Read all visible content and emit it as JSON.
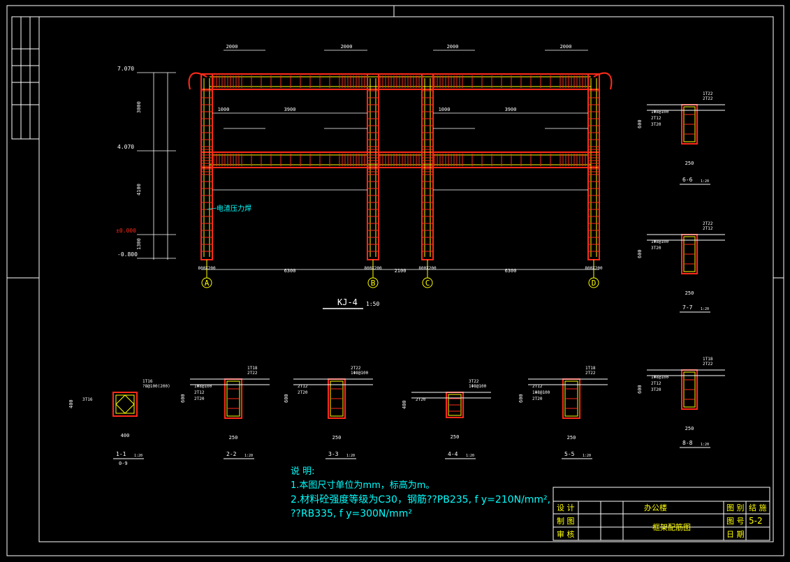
{
  "frame_title": {
    "text": "KJ-4",
    "scale": "1:50"
  },
  "axis_labels": [
    "A",
    "B",
    "C",
    "D"
  ],
  "span_labels": [
    "6300",
    "2100",
    "6300"
  ],
  "elevations": [
    "7.070",
    "4.070",
    "±0.000",
    "-0.800"
  ],
  "vertical_dims": [
    "3000",
    "4100",
    "1300"
  ],
  "top_dims": [
    "2000",
    "2000",
    "2000",
    "2000"
  ],
  "mid_dims": [
    "3900",
    "1000",
    "1000",
    "3900"
  ],
  "annotation": "电渣压力焊",
  "column_base": [
    "800X200",
    "800X200",
    "800X200",
    "800X200"
  ],
  "sections": [
    {
      "label": "1-1",
      "sub": "0-9",
      "dims": [
        "400",
        "400"
      ],
      "rebar": [
        "1T16",
        "?8@100(200)",
        "3T16"
      ]
    },
    {
      "label": "2-2",
      "dims": [
        "600",
        "250"
      ],
      "rebar": [
        "1T18",
        "2T22",
        "1Φ8@100",
        "2T12",
        "2T20"
      ]
    },
    {
      "label": "3-3",
      "dims": [
        "600",
        "250"
      ],
      "rebar": [
        "2T22",
        "1Φ8@100",
        "2T12",
        "2T20"
      ]
    },
    {
      "label": "4-4",
      "dims": [
        "400",
        "250"
      ],
      "rebar": [
        "3T22",
        "1Φ8@100",
        "2T20"
      ]
    },
    {
      "label": "5-5",
      "dims": [
        "600",
        "250"
      ],
      "rebar": [
        "1T18",
        "2T22",
        "2T12",
        "1Φ8@100",
        "2T20"
      ]
    },
    {
      "label": "6-6",
      "dims": [
        "600",
        "250"
      ],
      "rebar": [
        "1T22",
        "2T22",
        "1Φ8@100",
        "2T12",
        "3T20"
      ]
    },
    {
      "label": "7-7",
      "dims": [
        "600",
        "250"
      ],
      "rebar": [
        "2T22",
        "2T12",
        "1Φ8@100",
        "3T20"
      ]
    },
    {
      "label": "8-8",
      "dims": [
        "600",
        "250"
      ],
      "rebar": [
        "1T18",
        "2T22",
        "1Φ8@100",
        "2T12",
        "3T20"
      ]
    }
  ],
  "section_scale": "1:20",
  "notes": {
    "heading": "说 明:",
    "line1": "1.本图尺寸单位为mm，标高为m。",
    "line2": "2.材料砼强度等级为C30，钢筋??PB235, f  y=210N/mm²,",
    "line3": "??RB335, f  y=300N/mm²"
  },
  "title_block": {
    "design": "设 计",
    "draw": "制 图",
    "check": "审 核",
    "project": "办公楼",
    "drawing_name": "框架配筋图",
    "category_label": "图 别",
    "category": "结 施",
    "number_label": "图 号",
    "number": "5-2",
    "date_label": "日 期",
    "date": ""
  },
  "colors": {
    "frame": "#ffffff",
    "member": "#ff2a1a",
    "rebar": "#ffff00",
    "dim": "#ffffff",
    "text": "#ffffff",
    "green": "#33ff33",
    "note": "#00ffff"
  }
}
